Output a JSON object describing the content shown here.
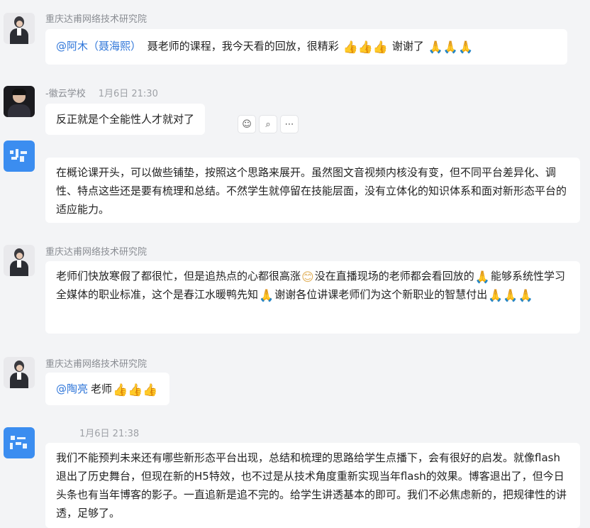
{
  "messages": [
    {
      "sender": "重庆达甫网络技术研究院",
      "time": "",
      "mention": "@阿木（聂海熙）",
      "text_parts": [
        "聂老师的课程，我今天看的回放，很精彩",
        "谢谢了"
      ],
      "emoji_after": [
        "👍👍👍",
        "🙏🙏🙏"
      ]
    },
    {
      "sender": "-徽云学校",
      "time": "1月6日 21:30",
      "text": "反正就是个全能性人才就对了",
      "actions": [
        "emoji-icon",
        "comment-icon",
        "more-icon"
      ]
    },
    {
      "sender": "",
      "time": "",
      "text": "在概论课开头，可以做些铺垫，按照这个思路来展开。虽然图文音视频内核没有变，但不同平台差异化、调性、特点这些还是要有梳理和总结。不然学生就停留在技能层面，没有立体化的知识体系和面对新形态平台的适应能力。"
    },
    {
      "sender": "重庆达甫网络技术研究院",
      "time": "",
      "segments": [
        {
          "t": "老师们快放寒假了都很忙，但是追热点的心都很高涨"
        },
        {
          "e": "😊"
        },
        {
          "t": "没在直播现场的老师都会看回放的"
        },
        {
          "e": "🙏"
        },
        {
          "t": "能够系统性学习全媒体的职业标准，这个是春江水暖鸭先知"
        },
        {
          "e": "🙏"
        },
        {
          "t": "谢谢各位讲课老师们为这个新职业的智慧付出"
        },
        {
          "e": "🙏🙏🙏"
        }
      ]
    },
    {
      "sender": "重庆达甫网络技术研究院",
      "time": "",
      "mention": "@陶亮",
      "text": "老师",
      "emoji": "👍👍👍"
    },
    {
      "sender": "",
      "time": "1月6日 21:38",
      "text": "我们不能预判未来还有哪些新形态平台出现，总结和梳理的思路给学生点播下，会有很好的启发。就像flash退出了历史舞台，但现在新的H5特效，也不过是从技术角度重新实现当年flash的效果。博客退出了，但今日头条也有当年博客的影子。一直追新是追不完的。给学生讲透基本的即可。我们不必焦虑新的，把规律性的讲透，足够了。"
    }
  ],
  "colors": {
    "background": "#f3f4f6",
    "bubble": "#ffffff",
    "mention": "#2f76d9",
    "sender": "#8a8d93",
    "avatar_blue": "#3b8df0"
  }
}
